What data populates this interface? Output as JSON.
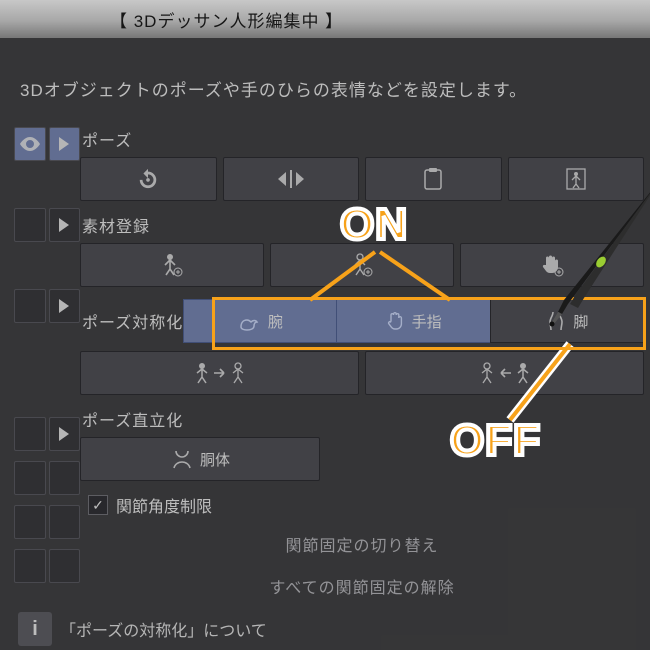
{
  "window": {
    "title": "【 3Dデッサン人形編集中 】"
  },
  "description": "3Dオブジェクトのポーズや手のひらの表情などを設定します。",
  "sections": {
    "pose": {
      "label": "ポーズ",
      "buttons": [
        "reset-rotation",
        "flip-horizontal",
        "clipboard",
        "default-pose"
      ]
    },
    "material": {
      "label": "素材登録",
      "buttons": [
        "register-full",
        "register-pose",
        "register-hand"
      ]
    },
    "symmetry": {
      "label": "ポーズ対称化",
      "segs": [
        {
          "icon": "arm-icon",
          "text": "腕",
          "selected": true
        },
        {
          "icon": "hand-icon",
          "text": "手指",
          "selected": true
        },
        {
          "icon": "leg-icon",
          "text": "脚",
          "selected": false
        }
      ],
      "mirror_buttons": [
        "mirror-left-to-right",
        "mirror-right-to-left"
      ]
    },
    "upright": {
      "label": "ポーズ直立化",
      "button": {
        "icon": "torso-icon",
        "text": "胴体"
      }
    },
    "joint": {
      "checkbox_label": "関節角度制限",
      "checked": true,
      "toggle_fix": "関節固定の切り替え",
      "release_all": "すべての関節固定の解除"
    }
  },
  "callouts": {
    "on": "ON",
    "off": "OFF"
  },
  "info": {
    "label": "「ポーズの対称化」について"
  }
}
